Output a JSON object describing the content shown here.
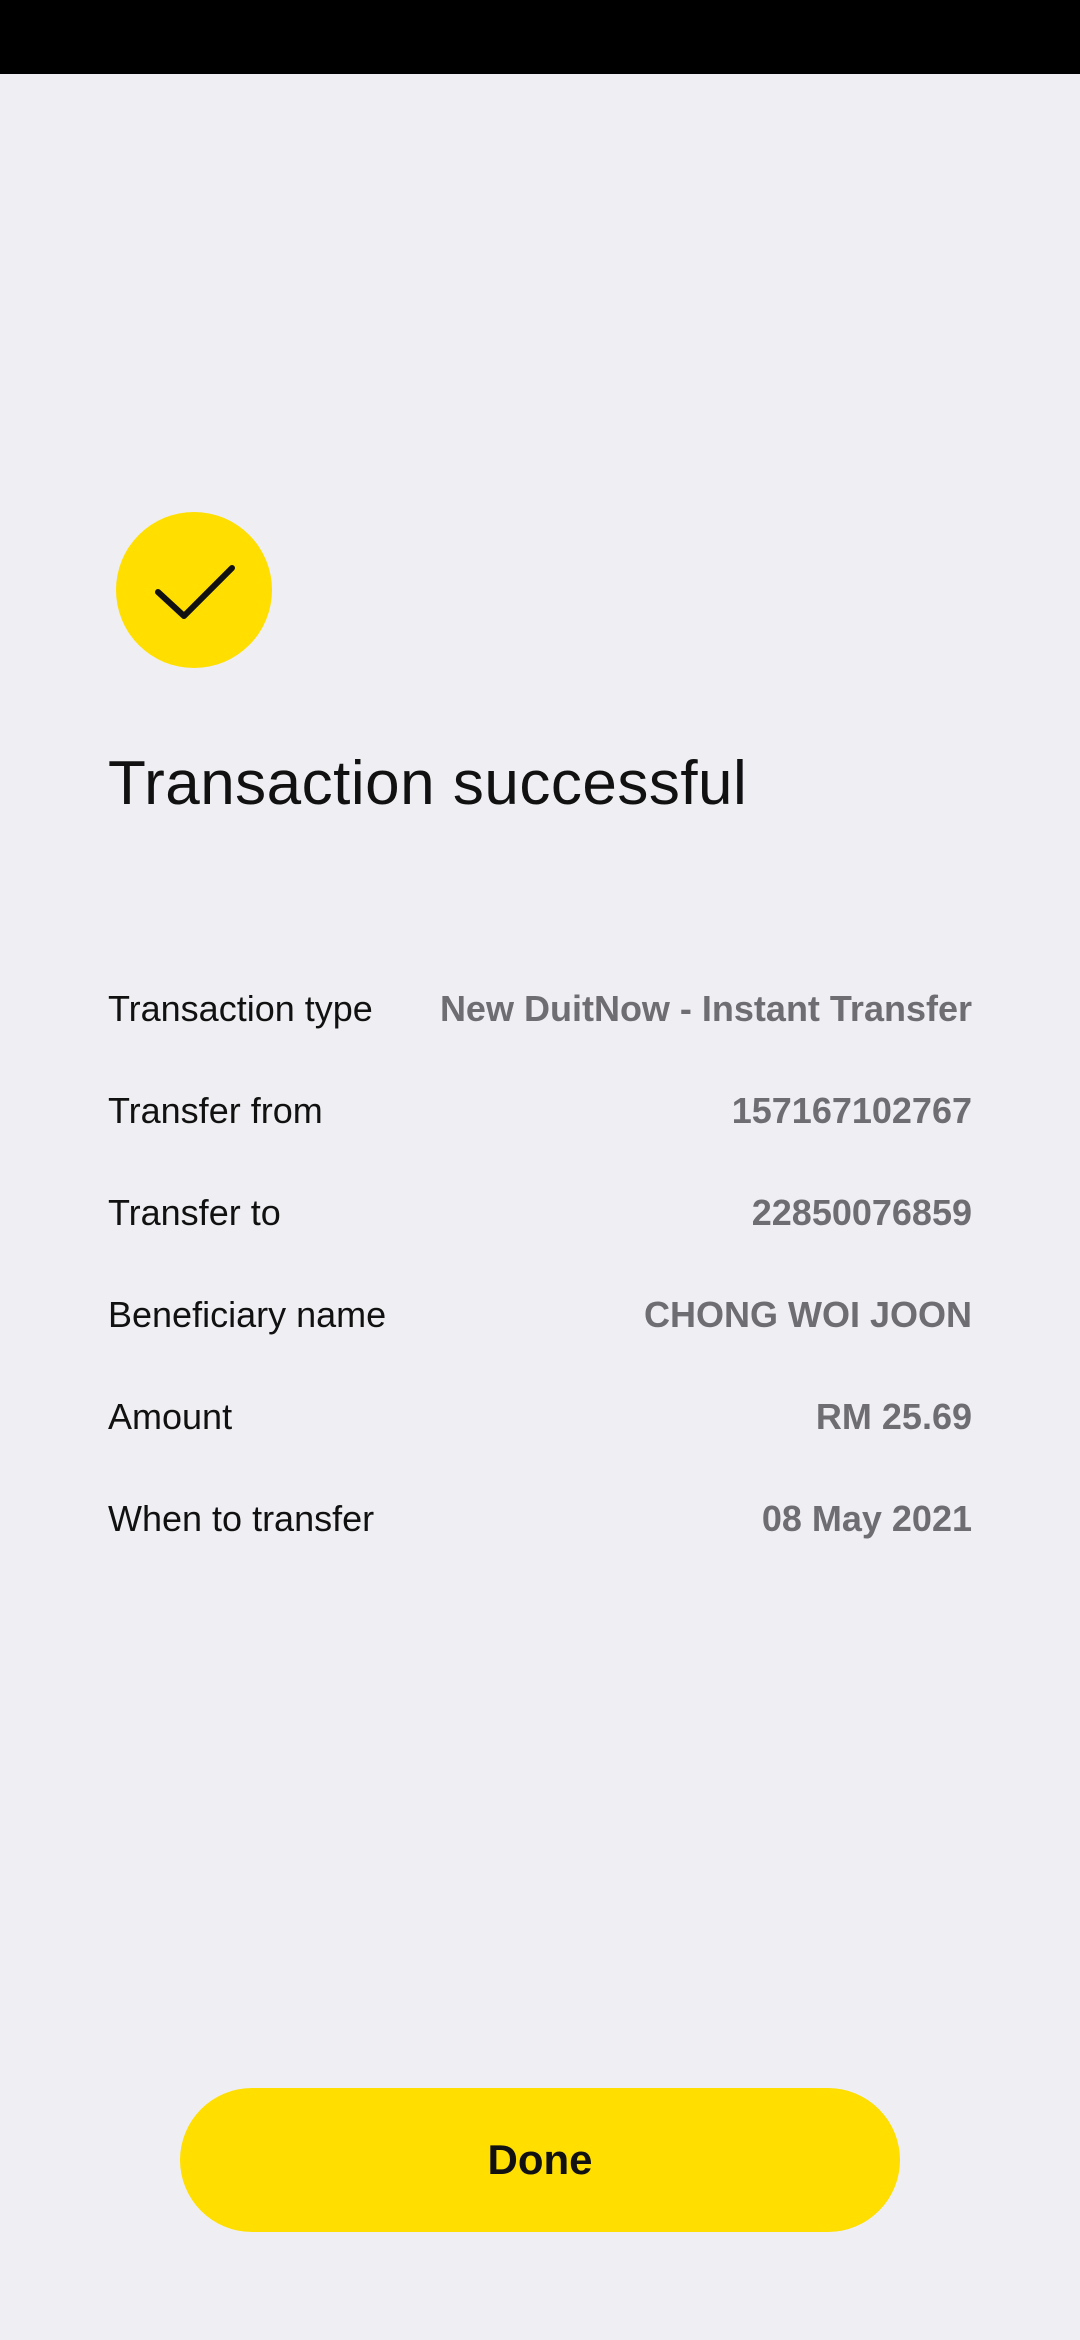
{
  "header": {
    "title": "Transaction successful",
    "status_icon": "checkmark-icon",
    "accent_color": "#ffde00"
  },
  "details": [
    {
      "label": "Transaction type",
      "value": "New DuitNow - Instant Transfer"
    },
    {
      "label": "Transfer from",
      "value": "157167102767"
    },
    {
      "label": "Transfer to",
      "value": "22850076859"
    },
    {
      "label": "Beneficiary name",
      "value": "CHONG WOI JOON"
    },
    {
      "label": "Amount",
      "value": "RM 25.69"
    },
    {
      "label": "When to transfer",
      "value": "08 May 2021"
    }
  ],
  "actions": {
    "done_label": "Done"
  }
}
